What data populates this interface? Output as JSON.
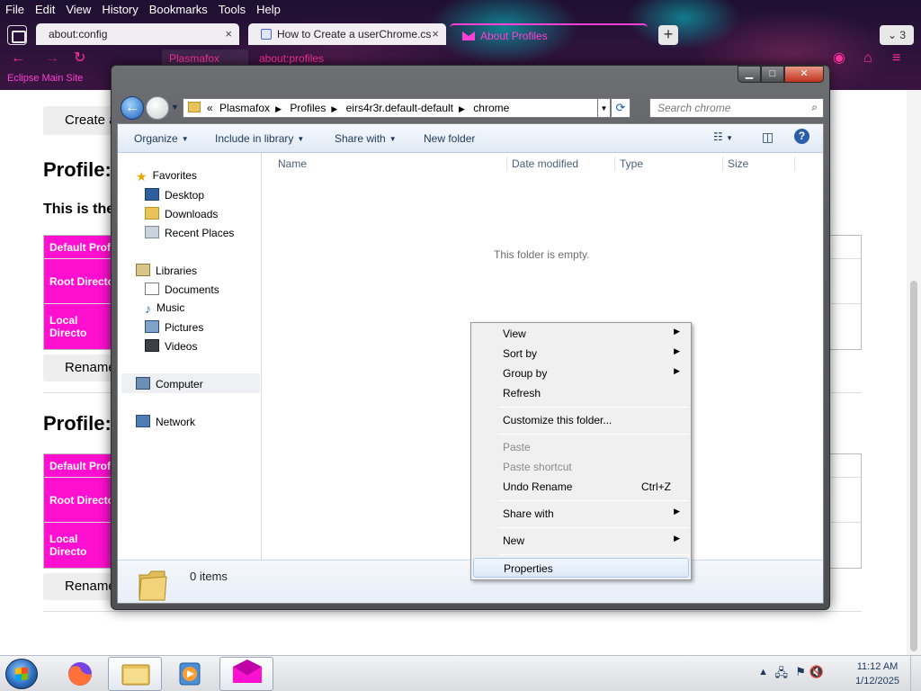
{
  "firefox": {
    "menu": [
      "File",
      "Edit",
      "View",
      "History",
      "Bookmarks",
      "Tools",
      "Help"
    ],
    "tabs": [
      {
        "label": "about:config",
        "close": "×"
      },
      {
        "label": "How to Create a userChrome.cs",
        "close": "×"
      },
      {
        "label": "About Profiles"
      }
    ],
    "new_tab": "+",
    "tab_count": "3",
    "url_pills": [
      "Plasmafox",
      "about:profiles"
    ],
    "bookmark": "Eclipse Main Site"
  },
  "page": {
    "create_button": "Create a",
    "profile_title": "Profile:",
    "profile_sub": "This is the",
    "rows": [
      "Default Prof",
      "Root Directo",
      "Local Directo"
    ],
    "rename_button": "Rename"
  },
  "explorer": {
    "breadcrumb_prefix": "«",
    "breadcrumb": [
      "Plasmafox",
      "Profiles",
      "eirs4r3r.default-default",
      "chrome"
    ],
    "search_placeholder": "Search chrome",
    "commands": [
      "Organize",
      "Include in library",
      "Share with",
      "New folder"
    ],
    "nav": {
      "favorites": "Favorites",
      "favorites_items": [
        "Desktop",
        "Downloads",
        "Recent Places"
      ],
      "libraries": "Libraries",
      "libraries_items": [
        "Documents",
        "Music",
        "Pictures",
        "Videos"
      ],
      "computer": "Computer",
      "network": "Network"
    },
    "columns": [
      "Name",
      "Date modified",
      "Type",
      "Size"
    ],
    "empty_text": "This folder is empty.",
    "item_count": "0 items"
  },
  "context_menu": {
    "view": "View",
    "sort_by": "Sort by",
    "group_by": "Group by",
    "refresh": "Refresh",
    "customize": "Customize this folder...",
    "paste": "Paste",
    "paste_shortcut": "Paste shortcut",
    "undo_rename": "Undo Rename",
    "undo_shortcut": "Ctrl+Z",
    "share_with": "Share with",
    "new": "New",
    "properties": "Properties"
  },
  "taskbar": {
    "time": "11:12 AM",
    "date": "1/12/2025"
  },
  "colors": {
    "accent_pink": "#ff0fd0",
    "firefox_dark": "#2a1238",
    "win_blue": "#1f5fb6"
  }
}
